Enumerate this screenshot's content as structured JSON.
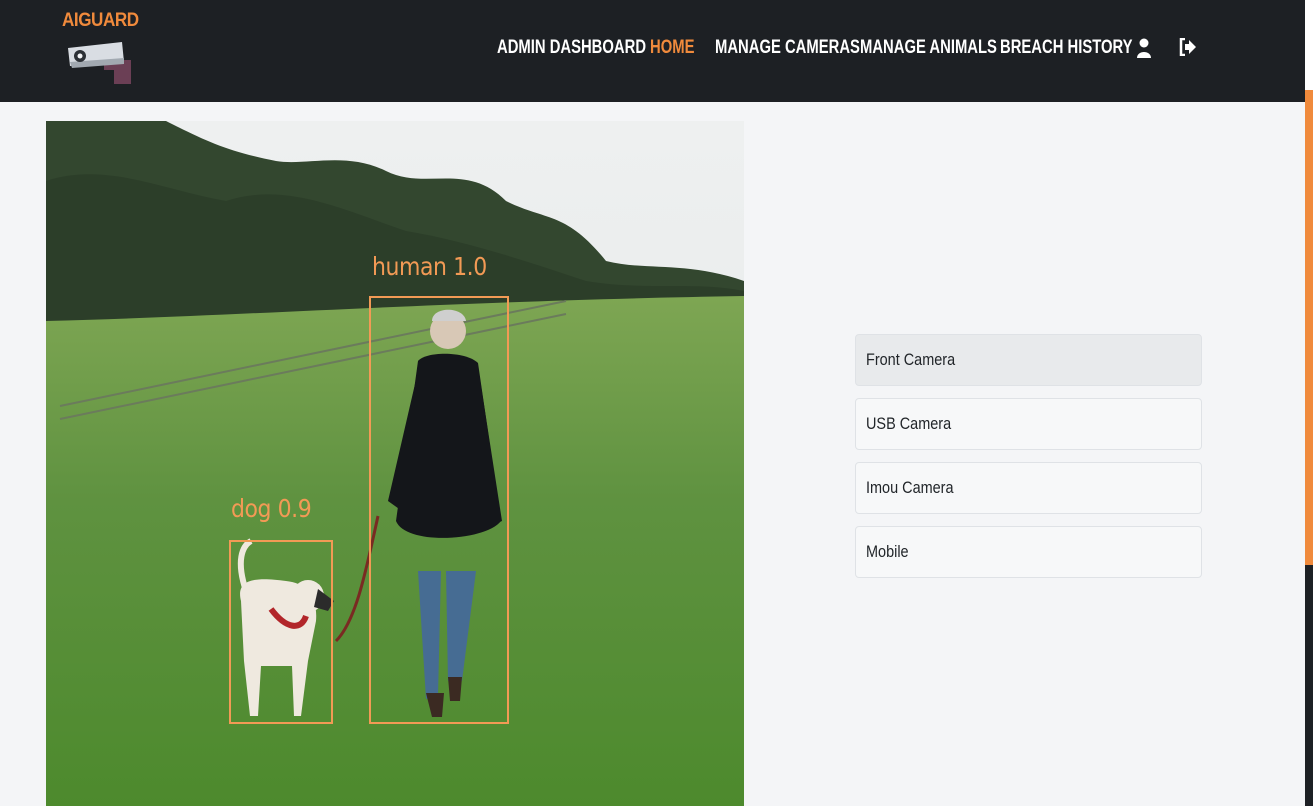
{
  "brand": {
    "name": "AIGUARD",
    "logo_icon": "security-camera-icon"
  },
  "nav": {
    "links": [
      {
        "label": "ADMIN DASHBOARD",
        "active": false
      },
      {
        "label": "HOME",
        "active": true
      },
      {
        "label": "MANAGE CAMERAS",
        "active": false
      },
      {
        "label": "MANAGE ANIMALS",
        "active": false
      },
      {
        "label": "BREACH HISTORY",
        "active": false
      }
    ],
    "icons": [
      "user-icon",
      "logout-icon"
    ]
  },
  "feed": {
    "detections": [
      {
        "label": "human 1.0"
      },
      {
        "label": "dog 0.9"
      }
    ]
  },
  "cameras": {
    "items": [
      {
        "label": "Front Camera",
        "selected": true
      },
      {
        "label": "USB Camera",
        "selected": false
      },
      {
        "label": "Imou Camera",
        "selected": false
      },
      {
        "label": "Mobile",
        "selected": false
      }
    ]
  },
  "colors": {
    "accent": "#f08a3c",
    "navbar_bg": "#1d2024",
    "page_bg": "#f4f5f7",
    "detection_box": "#f29a55"
  }
}
